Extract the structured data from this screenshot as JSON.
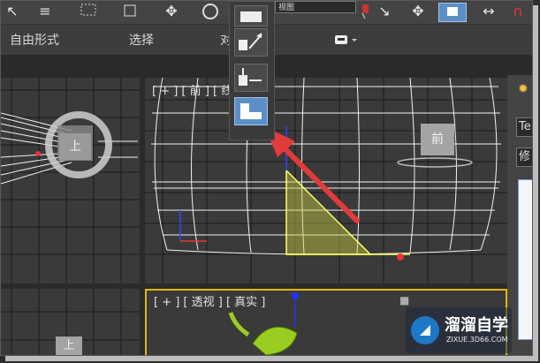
{
  "ribbon": {
    "tabs": [
      "自由形式",
      "选择",
      "对"
    ]
  },
  "viewports": {
    "front": {
      "label": "[ + ] [ 前 ] [ 线"
    },
    "perspective": {
      "label": "[ + ] [ 透视 ] [ 真实 ]"
    },
    "persp_cube_face": "前",
    "top_cube_face": "上"
  },
  "toolbar": {
    "field_value": "视图"
  },
  "right_panel": {
    "field1": "Te",
    "field2": "修"
  },
  "watermark": {
    "name": "溜溜自学",
    "url": "ZIXUE.3D66.COM"
  },
  "colors": {
    "viewport_bg": "#3a3a3a",
    "grid": "#1a1a1a",
    "wire": "#f2f2f2",
    "selected_wire": "#ffff66",
    "arrow": "#e33a3a",
    "flyout_selected": "#5c8fc6"
  }
}
